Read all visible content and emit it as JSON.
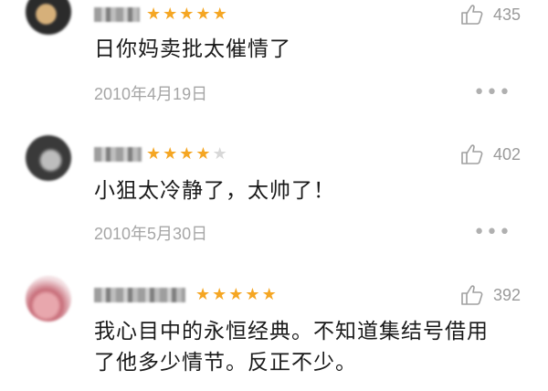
{
  "comments": [
    {
      "stars": [
        "★",
        "★",
        "★",
        "★",
        "★"
      ],
      "likes": "435",
      "text": "日你妈卖批太催情了",
      "date": "2010年4月19日",
      "more": "•••"
    },
    {
      "stars": [
        "★",
        "★",
        "★",
        "★"
      ],
      "stars_off": [
        "★"
      ],
      "likes": "402",
      "text": "小狙太冷静了，太帅了！",
      "date": "2010年5月30日",
      "more": "•••"
    },
    {
      "stars": [
        "★",
        "★",
        "★",
        "★",
        "★"
      ],
      "likes": "392",
      "text_line1": "我心目中的永恒经典。不知道集结号借用",
      "text_line2": "了他多少情节。反正不少。"
    }
  ],
  "colors": {
    "star": "#f5a623",
    "star_off": "#d8d8d8",
    "meta": "#a6a6a6"
  }
}
